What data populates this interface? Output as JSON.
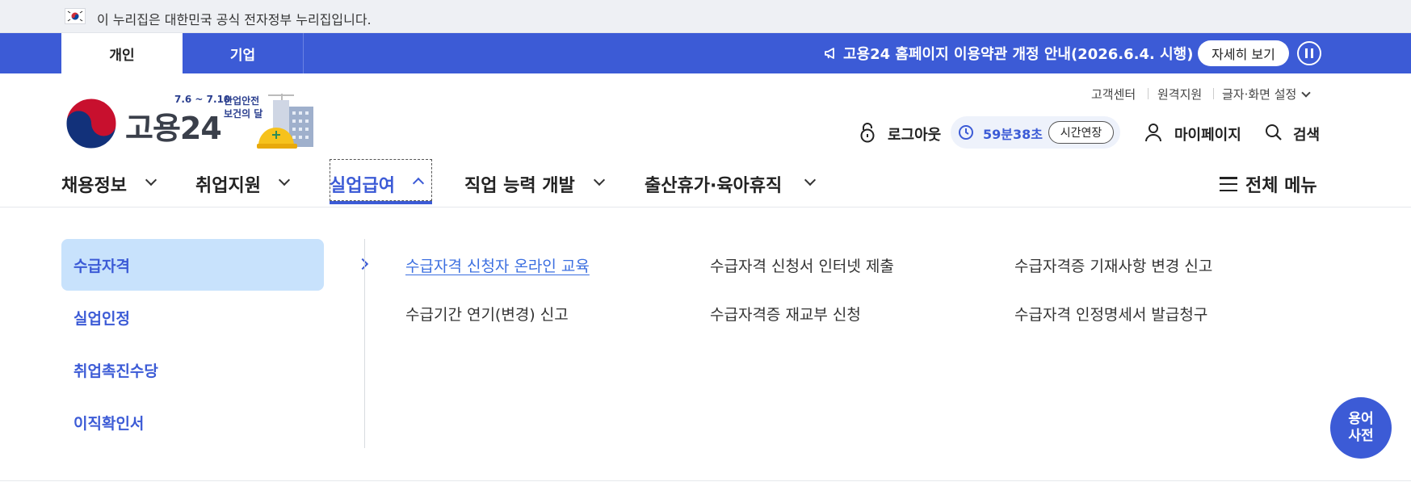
{
  "gov_banner": {
    "text": "이 누리집은 대한민국 공식 전자정부 누리집입니다."
  },
  "top_tabs": [
    {
      "label": "개인"
    },
    {
      "label": "기업"
    }
  ],
  "notice": {
    "text": "고용24 홈페이지 이용약관 개정 안내(2026.6.4. 시행)",
    "detail_label": "자세히 보기"
  },
  "logo": {
    "text": "고용24"
  },
  "event_badge": {
    "date": "7.6 ~ 7.10",
    "line1": "산업안전",
    "line2": "보건의 달"
  },
  "util_links": [
    {
      "label": "고객센터"
    },
    {
      "label": "원격지원"
    },
    {
      "label": "글자·화면 설정"
    }
  ],
  "header_actions": {
    "logout_label": "로그아웃",
    "timer_value": "59분38초",
    "extend_label": "시간연장",
    "mypage_label": "마이페이지",
    "search_label": "검색"
  },
  "main_nav": {
    "items": [
      {
        "label": "채용정보"
      },
      {
        "label": "취업지원"
      },
      {
        "label": "실업급여"
      },
      {
        "label": "직업 능력 개발"
      },
      {
        "label": "출산휴가·육아휴직"
      }
    ],
    "all_menu_label": "전체 메뉴"
  },
  "submenu": {
    "side_items": [
      {
        "label": "수급자격"
      },
      {
        "label": "실업인정"
      },
      {
        "label": "취업촉진수당"
      },
      {
        "label": "이직확인서"
      }
    ],
    "links": [
      {
        "label": "수급자격 신청자 온라인 교육"
      },
      {
        "label": "수급자격 신청서 인터넷 제출"
      },
      {
        "label": "수급자격증 기재사항 변경 신고"
      },
      {
        "label": "수급기간 연기(변경) 신고"
      },
      {
        "label": "수급자격증 재교부 신청"
      },
      {
        "label": "수급자격 인정명세서 발급청구"
      }
    ]
  },
  "glossary": {
    "line1": "용어",
    "line2": "사전"
  },
  "colors": {
    "primary": "#3c5bd6",
    "active_bg": "#c8e2fc",
    "banner_bg": "#eef0f4"
  }
}
